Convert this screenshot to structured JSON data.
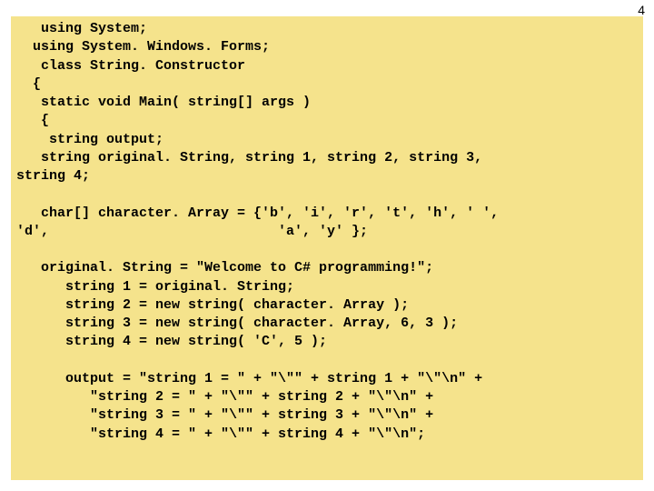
{
  "page_number": "4",
  "code": {
    "l01": "   using System;",
    "l02": "  using System. Windows. Forms;",
    "l03": "   class String. Constructor",
    "l04": "  {",
    "l05": "   static void Main( string[] args )",
    "l06": "   {",
    "l07": "    string output;",
    "l08": "   string original. String, string 1, string 2, string 3,",
    "l09": "string 4;",
    "l10": "",
    "l11": "   char[] character. Array = {'b', 'i', 'r', 't', 'h', ' ',",
    "l12": "'d',                            'a', 'y' };",
    "l13": "",
    "l14": "   original. String = \"Welcome to C# programming!\";",
    "l15": "      string 1 = original. String;",
    "l16": "      string 2 = new string( character. Array );",
    "l17": "      string 3 = new string( character. Array, 6, 3 );",
    "l18": "      string 4 = new string( 'C', 5 );",
    "l19": "",
    "l20": "      output = \"string 1 = \" + \"\\\"\" + string 1 + \"\\\"\\n\" +",
    "l21": "         \"string 2 = \" + \"\\\"\" + string 2 + \"\\\"\\n\" +",
    "l22": "         \"string 3 = \" + \"\\\"\" + string 3 + \"\\\"\\n\" +",
    "l23": "         \"string 4 = \" + \"\\\"\" + string 4 + \"\\\"\\n\";"
  }
}
